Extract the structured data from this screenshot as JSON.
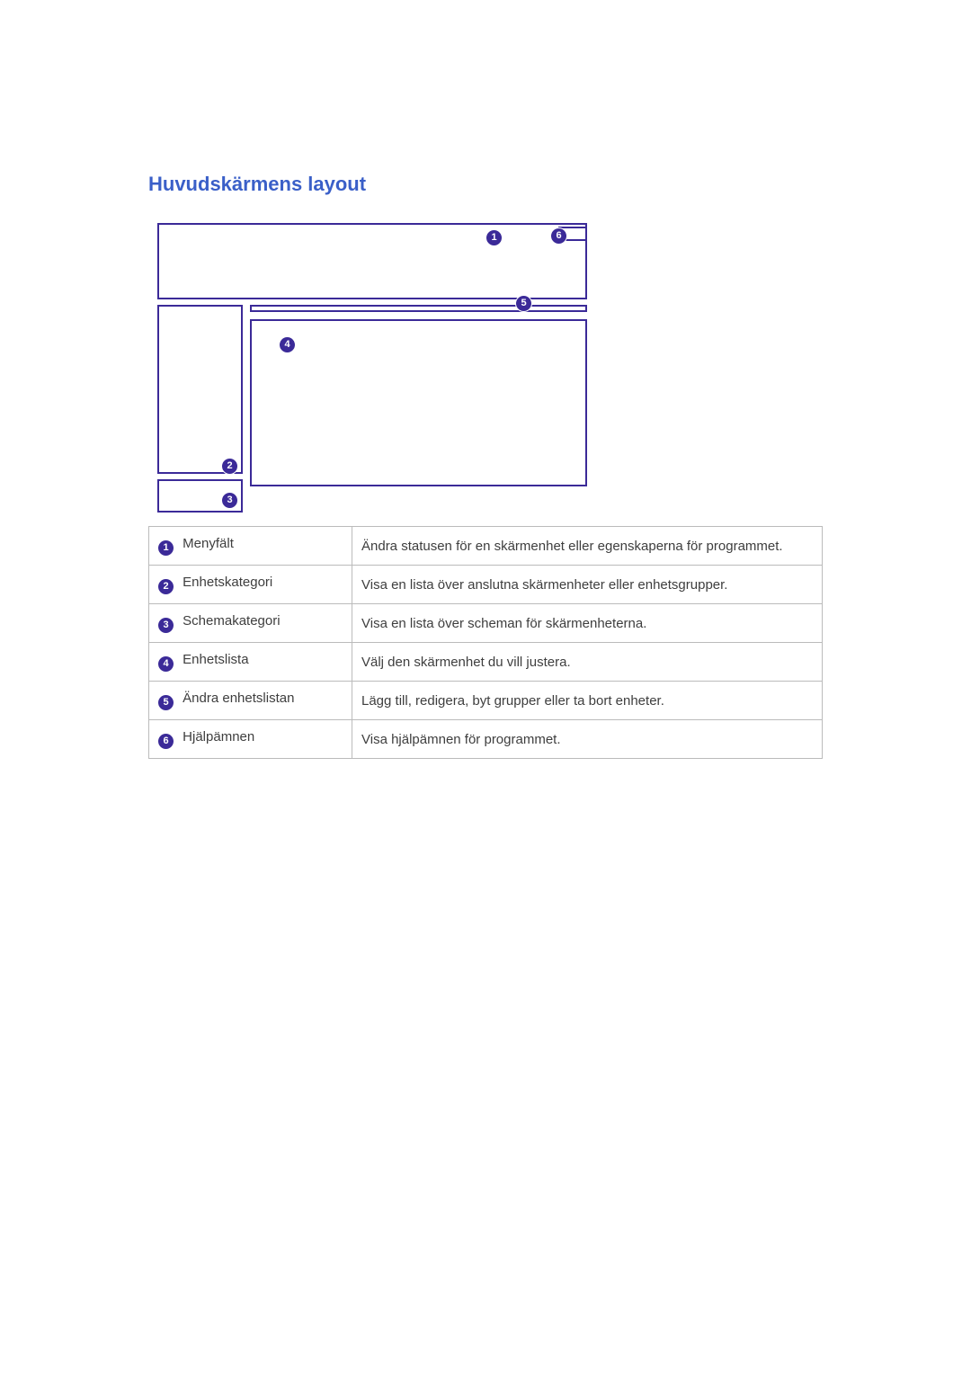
{
  "title": "Huvudskärmens layout",
  "callouts": {
    "c1": "1",
    "c2": "2",
    "c3": "3",
    "c4": "4",
    "c5": "5",
    "c6": "6"
  },
  "legend": [
    {
      "num": "1",
      "name": "Menyfält",
      "desc": "Ändra statusen för en skärmenhet eller egenskaperna för programmet."
    },
    {
      "num": "2",
      "name": "Enhetskategori",
      "desc": "Visa en lista över anslutna skärmenheter eller enhetsgrupper."
    },
    {
      "num": "3",
      "name": "Schemakategori",
      "desc": "Visa en lista över scheman för skärmenheterna."
    },
    {
      "num": "4",
      "name": "Enhetslista",
      "desc": "Välj den skärmenhet du vill justera."
    },
    {
      "num": "5",
      "name": "Ändra enhetslistan",
      "desc": "Lägg till, redigera, byt grupper eller ta bort enheter."
    },
    {
      "num": "6",
      "name": "Hjälpämnen",
      "desc": "Visa hjälpämnen för programmet."
    }
  ]
}
